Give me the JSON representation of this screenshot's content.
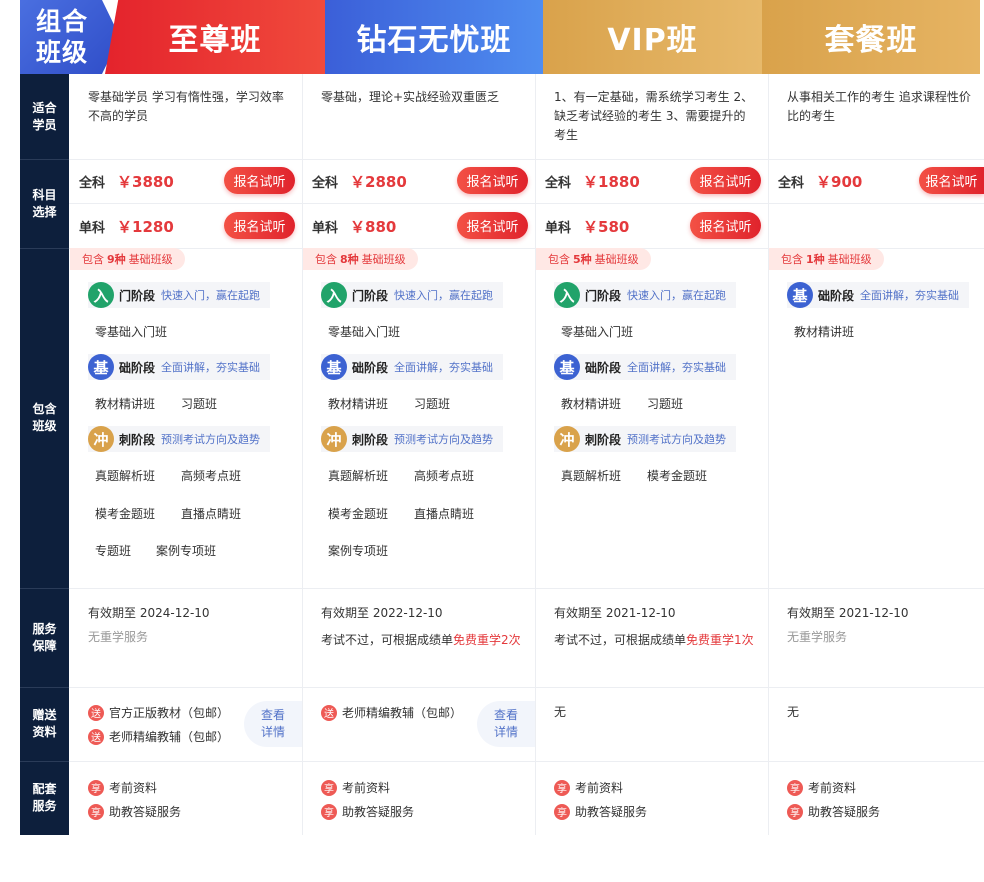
{
  "header": {
    "corner": "组合班级",
    "plans": [
      "至尊班",
      "钻石无忧班",
      "VIP班",
      "套餐班"
    ]
  },
  "rows": {
    "suitable": "适合学员",
    "subject": "科目选择",
    "classes": "包含班级",
    "service": "服务保障",
    "gift": "赠送资料",
    "support": "配套服务"
  },
  "suitable": [
    "零基础学员 学习有惰性强，学习效率不高的学员",
    "零基础，理论+实战经验双重匮乏",
    "1、有一定基础，需系统学习考生 2、缺乏考试经验的考生 3、需要提升的考生",
    "从事相关工作的考生 追求课程性价比的考生"
  ],
  "pricing": {
    "full_label": "全科",
    "single_label": "单科",
    "button": "报名试听",
    "full": [
      "￥3880",
      "￥2880",
      "￥1880",
      "￥900"
    ],
    "single": [
      "￥1280",
      "￥880",
      "￥580"
    ]
  },
  "classes": {
    "tag_prefix": "包含",
    "tag_suffix": "基础班级",
    "counts": [
      "9种",
      "8种",
      "5种",
      "1种"
    ],
    "stages": {
      "intro": {
        "icon": "入",
        "name": "门阶段",
        "desc": "快速入门，赢在起跑"
      },
      "base": {
        "icon": "基",
        "name": "础阶段",
        "desc": "全面讲解，夯实基础"
      },
      "sprint": {
        "icon": "冲",
        "name": "刺阶段",
        "desc": "预测考试方向及趋势"
      }
    },
    "courses": {
      "intro": "零基础入门班",
      "textbook": "教材精讲班",
      "exercise": "习题班",
      "real": "真题解析班",
      "hot": "高频考点班",
      "mock": "模考金题班",
      "live": "直播点睛班",
      "topic": "专题班",
      "case": "案例专项班"
    }
  },
  "service": {
    "valid_prefix": "有效期至 ",
    "dates": [
      "2024-12-10",
      "2022-12-10",
      "2021-12-10",
      "2021-12-10"
    ],
    "no_retake": "无重学服务",
    "retake_prefix": "考试不过，可根据成绩单",
    "retake_2": "免费重学2次",
    "retake_1": "免费重学1次"
  },
  "gift": {
    "icon": "送",
    "book1": "官方正版教材（包邮）",
    "book2": "老师精编教辅（包邮）",
    "detail": "查看详情",
    "none": "无"
  },
  "support": {
    "icon": "享",
    "item1": "考前资料",
    "item2": "助教答疑服务"
  },
  "colors": {
    "header_red": "#e4232c",
    "header_blue": "#3b5fd8",
    "header_gold": "#d9a24b",
    "sidebar": "#0d1f3c",
    "accent_red": "#e4393c",
    "desc_blue": "#5272c8"
  }
}
